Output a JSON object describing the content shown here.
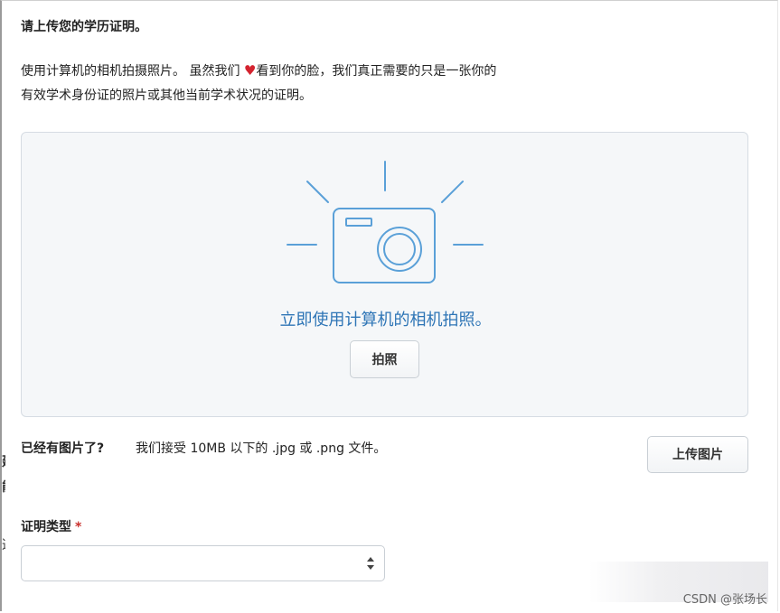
{
  "form": {
    "title": "请上传您的学历证明。",
    "description_part1": "使用计算机的相机拍摄照片。 虽然我们 ",
    "description_part2": "看到你的脸，我们真正需要的只是一张你的",
    "description_line2": "有效学术身份证的照片或其他当前学术状况的证明。",
    "heart_glyph": "♥"
  },
  "capture": {
    "hint": "立即使用计算机的相机拍照。",
    "take_photo_label": "拍照",
    "icon": "camera-icon",
    "icon_color": "#5aa0d8"
  },
  "upload": {
    "label": "已经有图片了?",
    "note": "我们接受 10MB 以下的 .jpg 或 .png 文件。",
    "button_label": "上传图片"
  },
  "proof_type": {
    "label": "证明类型",
    "required_mark": "*",
    "selected_value": ""
  },
  "left_edge_fragments": [
    "建",
    "能",
    "这"
  ],
  "watermark": "CSDN @张场长",
  "colors": {
    "accent_text": "#2e75b6",
    "heart": "#d4232f",
    "required": "#c9302c",
    "panel_bg": "#f5f7f9",
    "border": "#c9cfd5"
  }
}
